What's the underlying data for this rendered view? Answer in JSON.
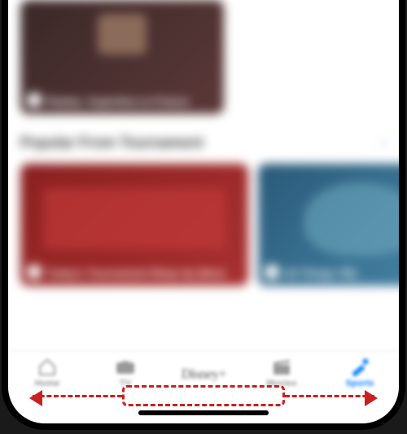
{
  "content": {
    "featured_card_caption": "Replay: Argentina vs France",
    "section_title": "Popular From Tournament",
    "card1_caption": "Today's Tournament Wrap Up (Nov)",
    "card2_caption": "All Things TBL"
  },
  "tabbar": {
    "items": [
      {
        "label": "Home",
        "active": false
      },
      {
        "label": "TV",
        "active": false
      },
      {
        "label": "Disney+",
        "active": false
      },
      {
        "label": "Movies",
        "active": false
      },
      {
        "label": "Sports",
        "active": true
      }
    ]
  },
  "annotation": {
    "description": "swipe-home-indicator-left-right"
  }
}
